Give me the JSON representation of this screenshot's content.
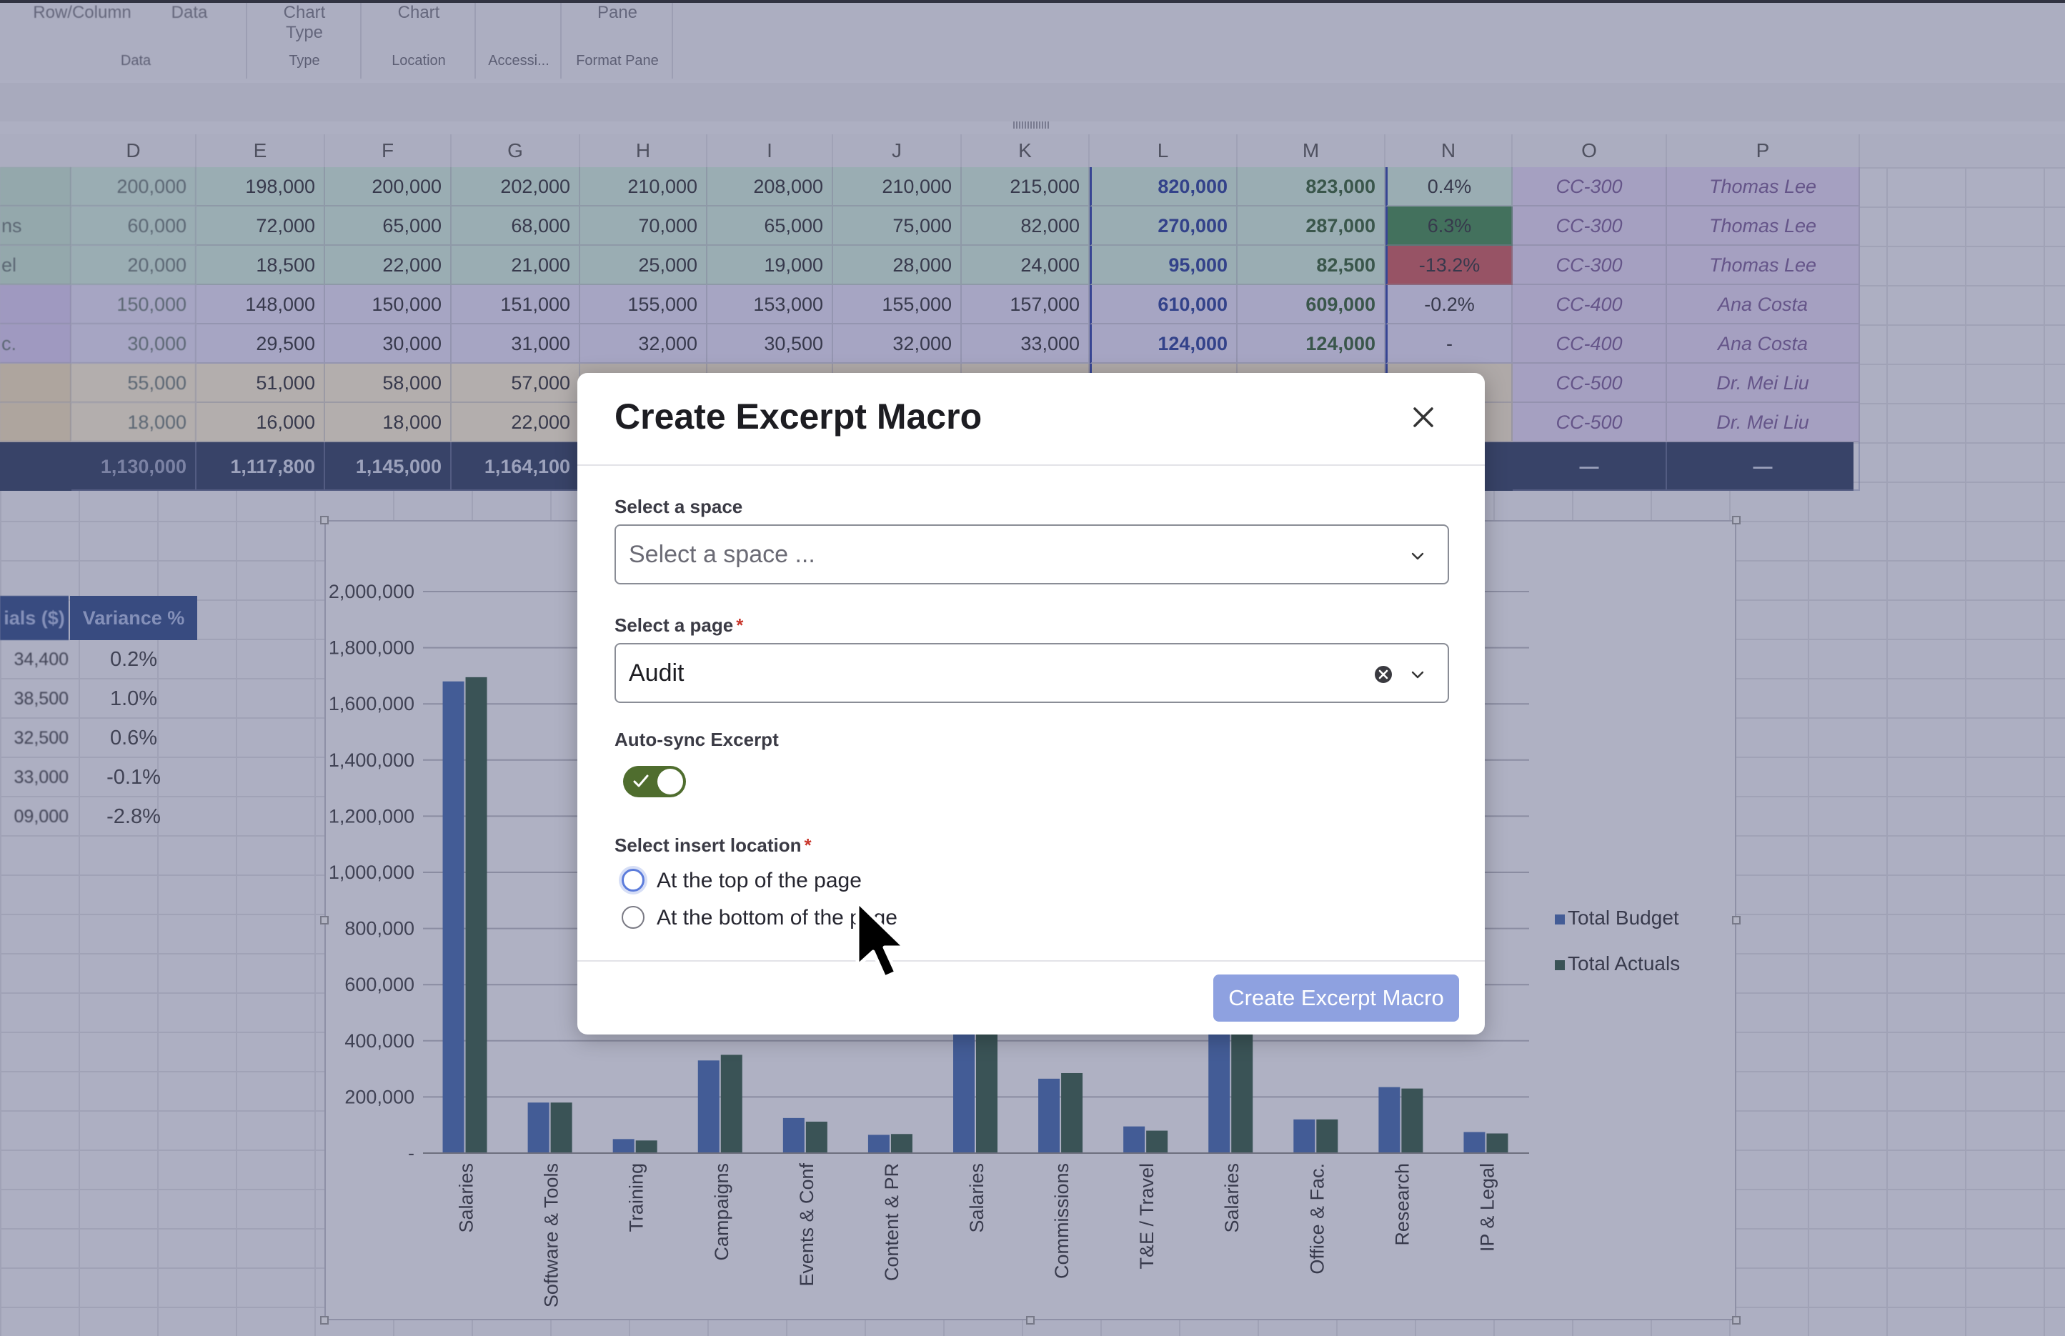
{
  "ribbon": {
    "buttons": [
      "Row/Column",
      "Data",
      "Chart\nType",
      "Chart",
      "Pane"
    ],
    "groups": [
      "Data",
      "Type",
      "Location",
      "Accessi...",
      "Format Pane"
    ]
  },
  "columns": [
    "D",
    "E",
    "F",
    "G",
    "H",
    "I",
    "J",
    "K",
    "L",
    "M",
    "N",
    "O",
    "P"
  ],
  "rows": [
    {
      "row_stub": "",
      "cells": [
        "200,000",
        "198,000",
        "200,000",
        "202,000",
        "210,000",
        "208,000",
        "210,000",
        "215,000",
        "820,000",
        "823,000",
        "0.4%",
        "CC-300",
        "Thomas Lee"
      ]
    },
    {
      "row_stub": "ns",
      "cells": [
        "60,000",
        "72,000",
        "65,000",
        "68,000",
        "70,000",
        "65,000",
        "75,000",
        "82,000",
        "270,000",
        "287,000",
        "6.3%",
        "CC-300",
        "Thomas Lee"
      ]
    },
    {
      "row_stub": "el",
      "cells": [
        "20,000",
        "18,500",
        "22,000",
        "21,000",
        "25,000",
        "19,000",
        "28,000",
        "24,000",
        "95,000",
        "82,500",
        "-13.2%",
        "CC-300",
        "Thomas Lee"
      ]
    },
    {
      "row_stub": "",
      "cells": [
        "150,000",
        "148,000",
        "150,000",
        "151,000",
        "155,000",
        "153,000",
        "155,000",
        "157,000",
        "610,000",
        "609,000",
        "-0.2%",
        "CC-400",
        "Ana Costa"
      ]
    },
    {
      "row_stub": "c.",
      "cells": [
        "30,000",
        "29,500",
        "30,000",
        "31,000",
        "32,000",
        "30,500",
        "32,000",
        "33,000",
        "124,000",
        "124,000",
        "-",
        "CC-400",
        "Ana Costa"
      ]
    },
    {
      "row_stub": "",
      "cells": [
        "55,000",
        "51,000",
        "58,000",
        "57,000",
        "",
        "",
        "",
        "",
        "",
        "",
        "",
        "CC-500",
        "Dr. Mei Liu"
      ]
    },
    {
      "row_stub": "",
      "cells": [
        "18,000",
        "16,000",
        "18,000",
        "22,000",
        "",
        "",
        "",
        "",
        "",
        "",
        "",
        "CC-500",
        "Dr. Mei Liu"
      ]
    }
  ],
  "total_row": [
    "1,130,000",
    "1,117,800",
    "1,145,000",
    "1,164,100",
    "—",
    "—"
  ],
  "side_table": {
    "headers": [
      "ials ($)",
      "Variance %"
    ],
    "rows": [
      [
        "34,400",
        "0.2%"
      ],
      [
        "38,500",
        "1.0%"
      ],
      [
        "32,500",
        "0.6%"
      ],
      [
        "33,000",
        "-0.1%"
      ],
      [
        "09,000",
        "-2.8%"
      ]
    ]
  },
  "chart_data": {
    "type": "bar",
    "categories": [
      "Salaries",
      "Software & Tools",
      "Training",
      "Campaigns",
      "Events & Conf",
      "Content & PR",
      "Salaries",
      "Commissions",
      "T&E / Travel",
      "Salaries",
      "Office & Fac.",
      "Research",
      "IP & Legal"
    ],
    "series": [
      {
        "name": "Total Budget",
        "color": "#2f57a0",
        "values": [
          1680000,
          180000,
          50000,
          330000,
          125000,
          65000,
          820000,
          265000,
          95000,
          810000,
          120000,
          235000,
          75000
        ]
      },
      {
        "name": "Total Actuals",
        "color": "#1f4733",
        "values": [
          1695000,
          180000,
          45000,
          350000,
          112000,
          68000,
          830000,
          285000,
          80000,
          815000,
          120000,
          230000,
          70000
        ]
      }
    ],
    "yticks": [
      "-",
      "200,000",
      "400,000",
      "600,000",
      "800,000",
      "1,000,000",
      "1,200,000",
      "1,400,000",
      "1,600,000",
      "1,800,000",
      "2,000,000"
    ],
    "ylim": [
      0,
      2000000
    ],
    "legend_position": "right",
    "grid": true
  },
  "dialog": {
    "title": "Create Excerpt Macro",
    "space_label": "Select a space",
    "space_placeholder": "Select a space ...",
    "page_label": "Select a page",
    "page_value": "Audit",
    "autosync_label": "Auto-sync Excerpt",
    "autosync_on": true,
    "location_label": "Select insert location",
    "location_options": [
      "At the top of the page",
      "At the bottom of the page"
    ],
    "submit_label": "Create Excerpt Macro",
    "required_mark": "*",
    "colors": {
      "accent": "#8ea1e0",
      "toggle": "#4f6d2e",
      "required": "#c9372c"
    }
  }
}
